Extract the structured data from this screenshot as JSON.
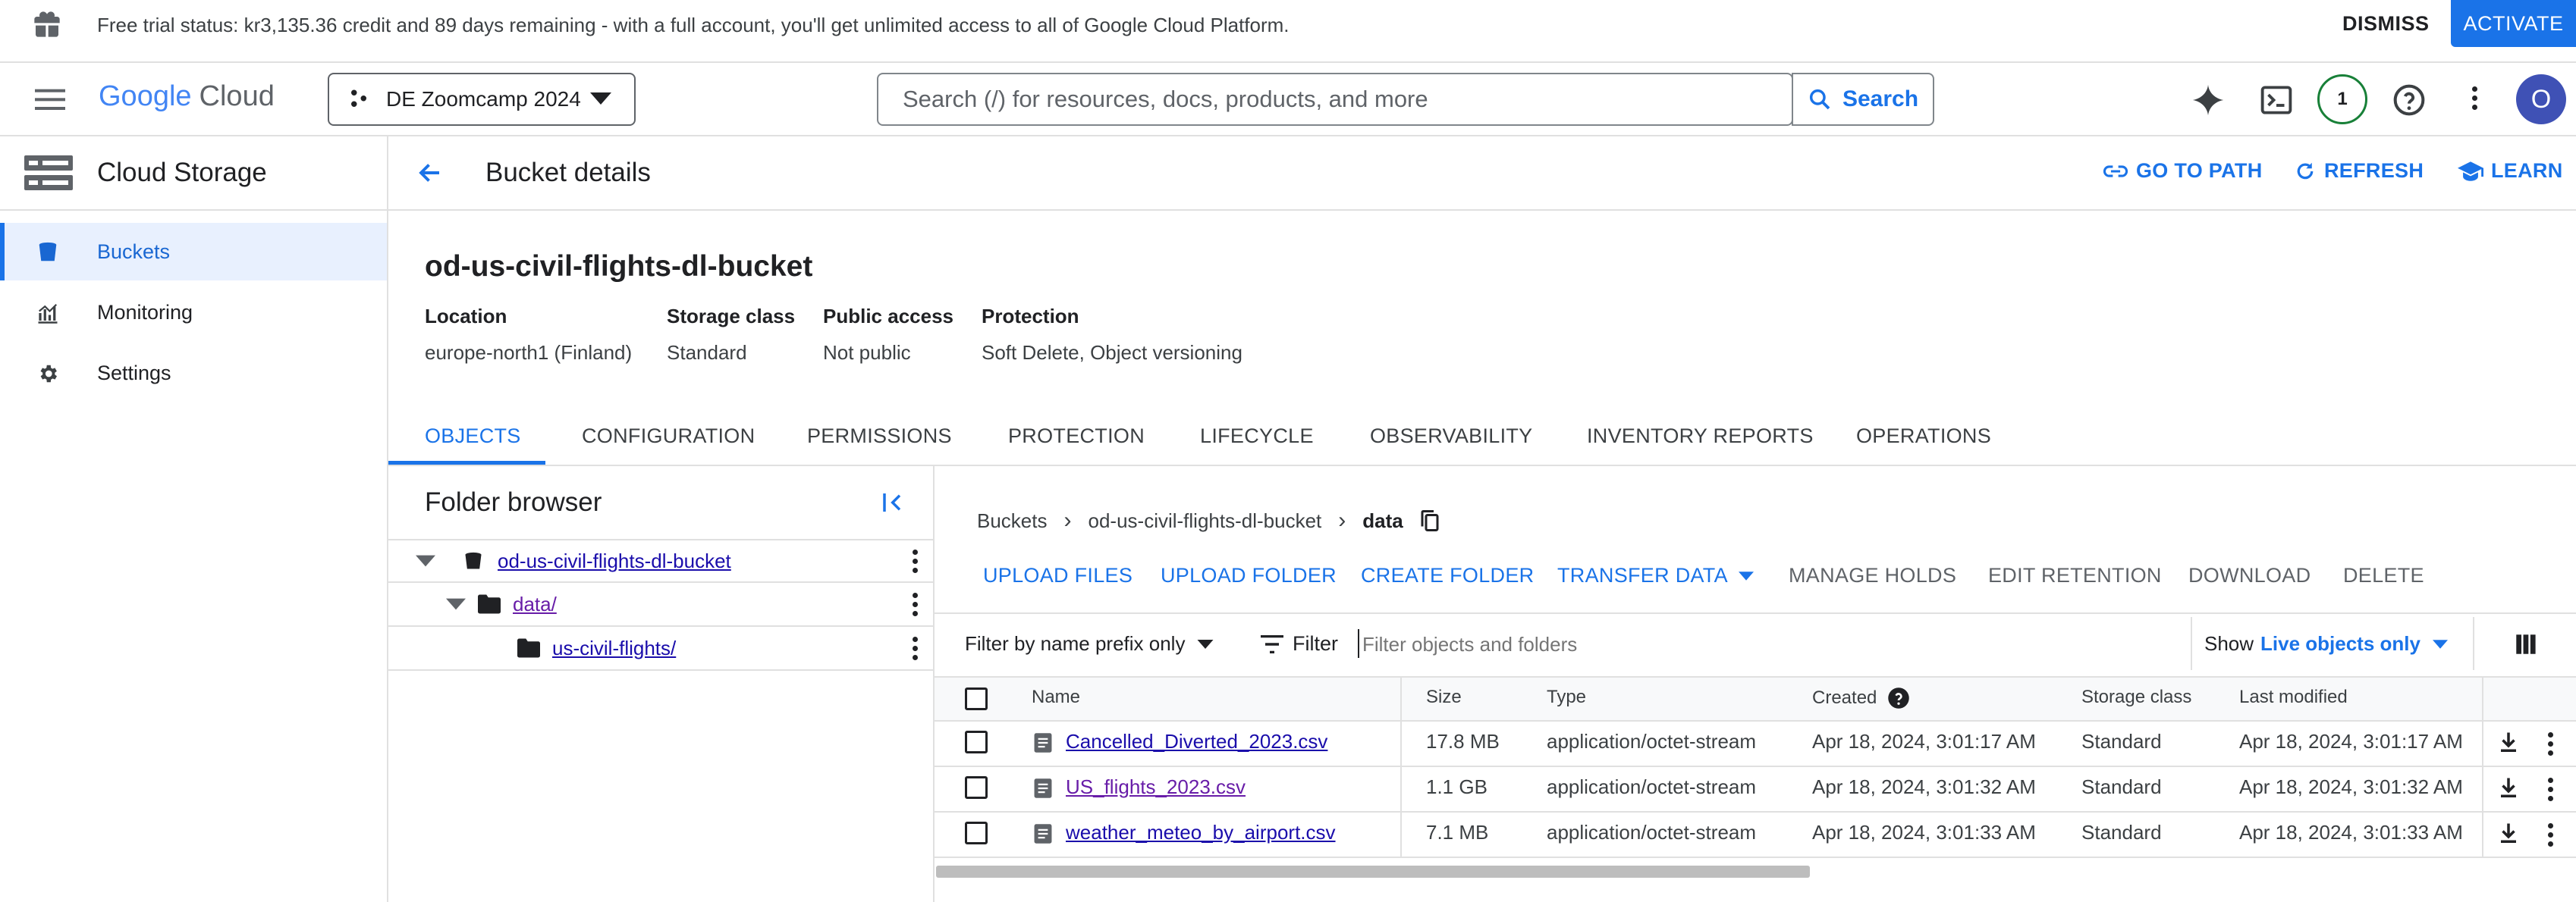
{
  "trial_banner": {
    "text": "Free trial status: kr3,135.36 credit and 89 days remaining - with a full account, you'll get unlimited access to all of Google Cloud Platform.",
    "dismiss": "DISMISS",
    "activate": "ACTIVATE"
  },
  "topbar": {
    "logo_google": "Google",
    "logo_cloud": "Cloud",
    "project": "DE Zoomcamp 2024",
    "search_placeholder": "Search (/) for resources, docs, products, and more",
    "search_button": "Search",
    "notifications_count": "1",
    "avatar_letter": "O"
  },
  "sidebar": {
    "title": "Cloud Storage",
    "items": [
      {
        "label": "Buckets",
        "icon": "bucket-icon",
        "active": true
      },
      {
        "label": "Monitoring",
        "icon": "chart-icon",
        "active": false
      },
      {
        "label": "Settings",
        "icon": "gear-icon",
        "active": false
      }
    ]
  },
  "header": {
    "title": "Bucket details",
    "go_to_path": "GO TO PATH",
    "refresh": "REFRESH",
    "learn": "LEARN"
  },
  "bucket": {
    "name": "od-us-civil-flights-dl-bucket",
    "props": [
      {
        "label": "Location",
        "value": "europe-north1 (Finland)"
      },
      {
        "label": "Storage class",
        "value": "Standard"
      },
      {
        "label": "Public access",
        "value": "Not public"
      },
      {
        "label": "Protection",
        "value": "Soft Delete, Object versioning"
      }
    ]
  },
  "tabs": [
    "OBJECTS",
    "CONFIGURATION",
    "PERMISSIONS",
    "PROTECTION",
    "LIFECYCLE",
    "OBSERVABILITY",
    "INVENTORY REPORTS",
    "OPERATIONS"
  ],
  "folder_browser": {
    "title": "Folder browser",
    "tree": [
      {
        "label": "od-us-civil-flights-dl-bucket"
      },
      {
        "label": "data/"
      },
      {
        "label": "us-civil-flights/"
      }
    ]
  },
  "breadcrumb": [
    "Buckets",
    "od-us-civil-flights-dl-bucket",
    "data"
  ],
  "actions": [
    "UPLOAD FILES",
    "UPLOAD FOLDER",
    "CREATE FOLDER",
    "TRANSFER DATA",
    "MANAGE HOLDS",
    "EDIT RETENTION",
    "DOWNLOAD",
    "DELETE"
  ],
  "filter_bar": {
    "prefix_select": "Filter by name prefix only",
    "filter_label": "Filter",
    "filter_placeholder": "Filter objects and folders",
    "show_label": "Show",
    "show_value": "Live objects only"
  },
  "table": {
    "columns": [
      "Name",
      "Size",
      "Type",
      "Created",
      "Storage class",
      "Last modified"
    ],
    "rows": [
      {
        "name": "Cancelled_Diverted_2023.csv",
        "size": "17.8 MB",
        "type": "application/octet-stream",
        "created": "Apr 18, 2024, 3:01:17 AM",
        "storage_class": "Standard",
        "last_modified": "Apr 18, 2024, 3:01:17 AM"
      },
      {
        "name": "US_flights_2023.csv",
        "size": "1.1 GB",
        "type": "application/octet-stream",
        "created": "Apr 18, 2024, 3:01:32 AM",
        "storage_class": "Standard",
        "last_modified": "Apr 18, 2024, 3:01:32 AM"
      },
      {
        "name": "weather_meteo_by_airport.csv",
        "size": "7.1 MB",
        "type": "application/octet-stream",
        "created": "Apr 18, 2024, 3:01:33 AM",
        "storage_class": "Standard",
        "last_modified": "Apr 18, 2024, 3:01:33 AM"
      }
    ]
  },
  "colors": {
    "accent": "#1a73e8",
    "active_bg": "#e8f0fe",
    "visited_link": "#681da8"
  }
}
